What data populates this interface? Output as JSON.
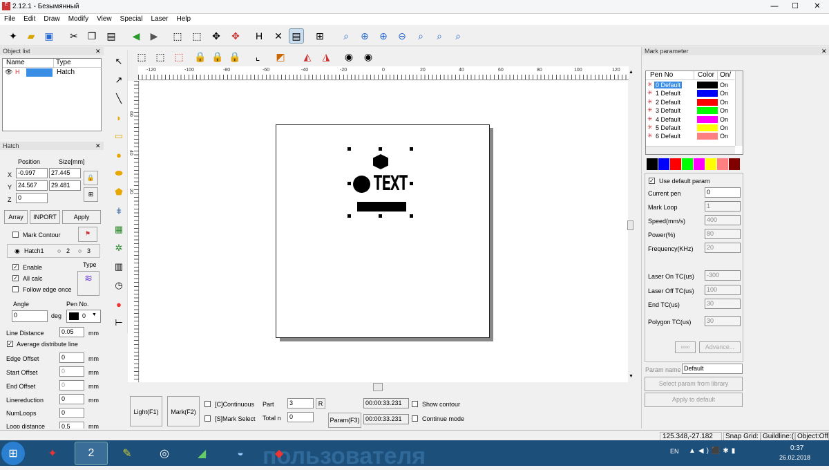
{
  "app": {
    "title": "2.12.1 - Безымянный",
    "minimize": "—",
    "maximize": "☐",
    "close": "✕"
  },
  "menu": [
    "File",
    "Edit",
    "Draw",
    "Modify",
    "View",
    "Special",
    "Laser",
    "Help"
  ],
  "object_list": {
    "title": "Object list",
    "col_name": "Name",
    "col_type": "Type",
    "row_type": "Hatch"
  },
  "hatch_panel": {
    "title": "Hatch",
    "position": "Position",
    "size": "Size[mm]",
    "x_label": "X",
    "y_label": "Y",
    "z_label": "Z",
    "x_pos": "-0.997",
    "x_size": "27.445",
    "y_pos": "24.567",
    "y_size": "29.481",
    "z_pos": "0",
    "array": "Array",
    "inport": "INPORT",
    "apply": "Apply",
    "mark_contour": "Mark Contour",
    "hatch1": "Hatch1",
    "hatch2": "2",
    "hatch3": "3",
    "type": "Type",
    "enable": "Enable",
    "all_calc": "All calc",
    "follow_edge": "Follow edge once",
    "angle": "Angle",
    "angle_val": "0",
    "deg": "deg",
    "pen_no": "Pen No.",
    "pen_val": "0",
    "line_distance": "Line Distance",
    "line_distance_val": "0.05",
    "avg_dist": "Average distribute line",
    "edge_offset": "Edge Offset",
    "edge_offset_val": "0",
    "start_offset": "Start Offset",
    "start_offset_val": "0",
    "end_offset": "End Offset",
    "end_offset_val": "0",
    "linereduction": "Linereduction",
    "linereduction_val": "0",
    "numloops": "NumLoops",
    "numloops_val": "0",
    "loop_distance": "Loop distance",
    "loop_distance_val": "0.5",
    "mm": "mm"
  },
  "ruler": {
    "h_ticks": [
      "-120",
      "-100",
      "-80",
      "-60",
      "-40",
      "-20",
      "0",
      "20",
      "40",
      "60",
      "80",
      "100",
      "120"
    ],
    "v_ticks": [
      "60",
      "40",
      "20"
    ]
  },
  "canvas_text": "TEXT",
  "bottom": {
    "light": "Light(F1)",
    "mark": "Mark(F2)",
    "continuous": "[C]Continuous",
    "mark_select": "[S]Mark Select",
    "part": "Part",
    "part_val": "3",
    "r": "R",
    "total": "Total n",
    "total_val": "0",
    "time1": "00:00:33.231",
    "time2": "00:00:33.231",
    "param": "Param(F3)",
    "show_contour": "Show contour",
    "continue_mode": "Continue mode"
  },
  "mark_param": {
    "title": "Mark parameter",
    "col_pen": "Pen No",
    "col_color": "Color",
    "col_on": "On/",
    "pens": [
      {
        "name": "0 Default",
        "color": "#000000",
        "on": "On"
      },
      {
        "name": "1 Default",
        "color": "#0000ff",
        "on": "On"
      },
      {
        "name": "2 Default",
        "color": "#ff0000",
        "on": "On"
      },
      {
        "name": "3 Default",
        "color": "#00ff00",
        "on": "On"
      },
      {
        "name": "4 Default",
        "color": "#ff00ff",
        "on": "On"
      },
      {
        "name": "5 Default",
        "color": "#ffff00",
        "on": "On"
      },
      {
        "name": "6 Default",
        "color": "#ff8080",
        "on": "On"
      }
    ],
    "swatches": [
      "#000000",
      "#0000ff",
      "#ff0000",
      "#00ff00",
      "#ff00ff",
      "#ffff00",
      "#ff8080",
      "#800000"
    ],
    "use_default": "Use default param",
    "current_pen": "Current pen",
    "current_pen_val": "0",
    "mark_loop": "Mark Loop",
    "mark_loop_val": "1",
    "speed": "Speed(mm/s)",
    "speed_val": "400",
    "power": "Power(%)",
    "power_val": "80",
    "freq": "Frequency(KHz)",
    "freq_val": "20",
    "laser_on": "Laser On TC(us)",
    "laser_on_val": "-300",
    "laser_off": "Laser Off TC(us)",
    "laser_off_val": "100",
    "end_tc": "End TC(us)",
    "end_tc_val": "30",
    "polygon_tc": "Polygon TC(us)",
    "polygon_tc_val": "30",
    "advance": "Advance...",
    "param_name": "Param name",
    "param_name_val": "Default",
    "select_library": "Select param from library",
    "apply_default": "Apply to default"
  },
  "status": {
    "coords": "125.348,-27.182",
    "snap": "Snap Grid:",
    "guide": "Guildline:(",
    "object": "Object:Off"
  },
  "taskbar": {
    "lang": "EN",
    "time": "0:37",
    "date": "26.02.2018",
    "bg_text": "пользователя"
  }
}
